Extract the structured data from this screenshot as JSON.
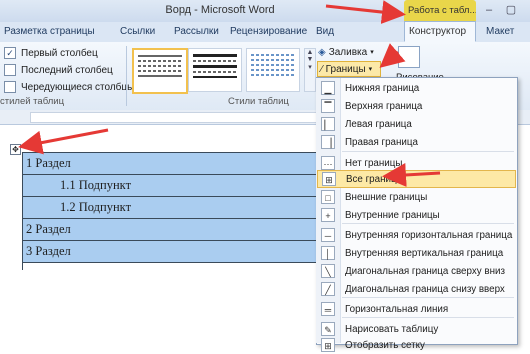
{
  "window": {
    "title": "Ворд - Microsoft Word"
  },
  "ribbon_tabs": {
    "context_group": "Работа с табл...",
    "items": [
      "Ссылки",
      "Рассылки",
      "Рецензирование",
      "Вид"
    ],
    "first_partial": "Разметка страницы",
    "constructor": "Конструктор",
    "layout": "Макет"
  },
  "table_style_options": {
    "first_column": "Первый столбец",
    "last_column": "Последний столбец",
    "banded_columns": "Чередующиеся столбцы",
    "group_label": "стилей таблиц"
  },
  "table_styles": {
    "group_label": "Стили таблиц"
  },
  "toolbar": {
    "shading_label": "Заливка",
    "borders_label": "Границы",
    "draw_label": "Рисование"
  },
  "document_table": {
    "rows": [
      "1 Раздел",
      "1.1 Подпункт",
      "1.2 Подпункт",
      "2 Раздел",
      "3 Раздел"
    ]
  },
  "borders_menu": {
    "items": [
      {
        "label": "Нижняя граница",
        "icon": "bottom-border-icon"
      },
      {
        "label": "Верхняя граница",
        "icon": "top-border-icon"
      },
      {
        "label": "Левая граница",
        "icon": "left-border-icon"
      },
      {
        "label": "Правая граница",
        "icon": "right-border-icon"
      },
      {
        "label": "Нет границы",
        "icon": "no-border-icon"
      },
      {
        "label": "Все границы",
        "icon": "all-borders-icon"
      },
      {
        "label": "Внешние границы",
        "icon": "outside-borders-icon"
      },
      {
        "label": "Внутренние границы",
        "icon": "inside-borders-icon"
      },
      {
        "label": "Внутренняя горизонтальная граница",
        "icon": "inside-horizontal-border-icon"
      },
      {
        "label": "Внутренняя вертикальная граница",
        "icon": "inside-vertical-border-icon"
      },
      {
        "label": "Диагональная граница сверху вниз",
        "icon": "diagonal-down-border-icon"
      },
      {
        "label": "Диагональная граница снизу вверх",
        "icon": "diagonal-up-border-icon"
      },
      {
        "label": "Горизонтальная линия",
        "icon": "horizontal-line-icon"
      },
      {
        "label": "Нарисовать таблицу",
        "icon": "draw-table-icon"
      },
      {
        "label": "Отобразить сетку",
        "icon": "view-gridlines-icon"
      }
    ],
    "highlighted": "Все границы"
  },
  "colors": {
    "accent_red": "#e53935",
    "table_fill": "#aacdf0",
    "context_tab": "#e9d64a",
    "highlight": "#fde9a6"
  }
}
